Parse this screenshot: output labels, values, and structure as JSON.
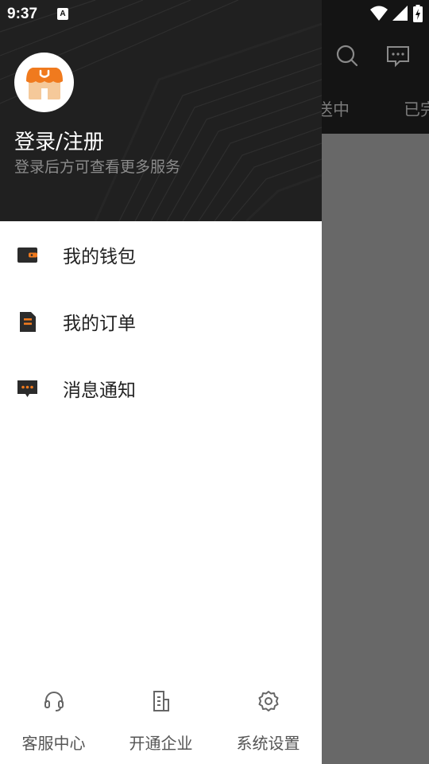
{
  "status_bar": {
    "time": "9:37",
    "notification_letter": "A"
  },
  "background": {
    "tabs": [
      "送中",
      "已完"
    ]
  },
  "drawer": {
    "login_title": "登录/注册",
    "login_subtitle": "登录后方可查看更多服务",
    "menu": [
      {
        "label": "我的钱包",
        "icon": "wallet-icon"
      },
      {
        "label": "我的订单",
        "icon": "order-icon"
      },
      {
        "label": "消息通知",
        "icon": "message-icon"
      }
    ],
    "bottom": [
      {
        "label": "客服中心",
        "icon": "headset-icon"
      },
      {
        "label": "开通企业",
        "icon": "enterprise-icon"
      },
      {
        "label": "系统设置",
        "icon": "settings-icon"
      }
    ]
  },
  "colors": {
    "accent": "#f07a1e",
    "drawer_header": "#202020",
    "scrim": "#686868"
  }
}
